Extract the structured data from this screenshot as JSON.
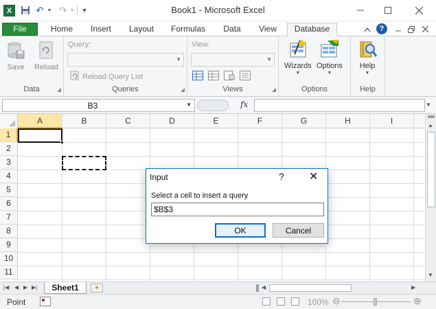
{
  "window": {
    "title": "Book1 - Microsoft Excel",
    "app_icon": "X",
    "min_icon": "minimize-icon",
    "max_icon": "maximize-icon",
    "close_icon": "close-icon"
  },
  "tabs": [
    {
      "label": "File"
    },
    {
      "label": "Home"
    },
    {
      "label": "Insert"
    },
    {
      "label": "Layout"
    },
    {
      "label": "Formulas"
    },
    {
      "label": "Data"
    },
    {
      "label": "View"
    },
    {
      "label": "Database",
      "active": true
    }
  ],
  "ribbon": {
    "groups": {
      "data": {
        "label": "Data",
        "save_label": "Save",
        "reload_label": "Reload"
      },
      "queries": {
        "label": "Queries",
        "query_label": "Query:",
        "reload_list_label": "Reload Query List"
      },
      "views": {
        "label": "Views",
        "view_label": "View:"
      },
      "options": {
        "label": "Options",
        "wizards_label": "Wizards",
        "options_label": "Options"
      },
      "help": {
        "label": "Help",
        "help_label": "Help"
      }
    }
  },
  "formula_bar": {
    "name_box": "B3",
    "fx": "fx",
    "formula": ""
  },
  "grid": {
    "columns": [
      "A",
      "B",
      "C",
      "D",
      "E",
      "F",
      "G",
      "H",
      "I"
    ],
    "rows": [
      "1",
      "2",
      "3",
      "4",
      "5",
      "6",
      "7",
      "8",
      "9",
      "10",
      "11"
    ],
    "active_cell": "A1",
    "copy_marquee_cell": "B3"
  },
  "sheets": {
    "tabs": [
      "Sheet1"
    ]
  },
  "status": {
    "mode": "Point",
    "zoom": "100%"
  },
  "dialog": {
    "title": "Input",
    "help_glyph": "?",
    "close_glyph": "✕",
    "prompt": "Select a cell to insert a query",
    "value": "$B$3",
    "ok_label": "OK",
    "cancel_label": "Cancel"
  },
  "colors": {
    "accent": "#0f6ccd",
    "file_tab": "#2a8c3a",
    "active_header": "#fde7a8"
  }
}
